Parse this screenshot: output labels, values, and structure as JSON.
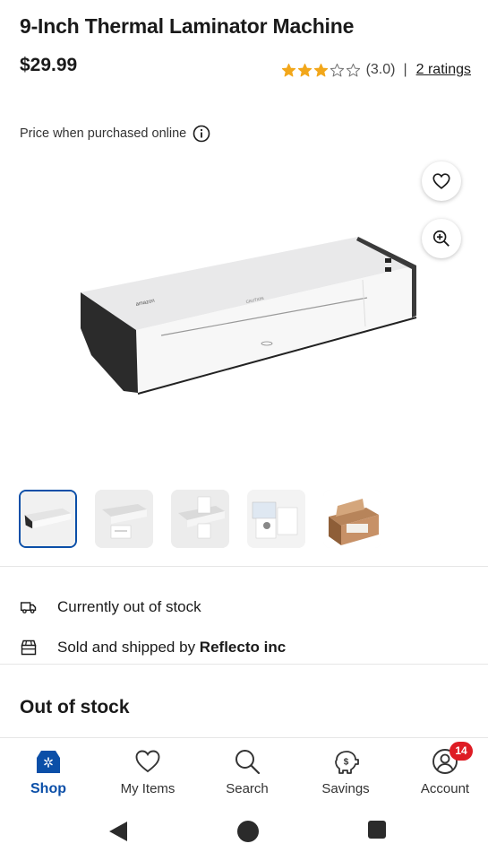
{
  "product": {
    "title": "9-Inch Thermal Laminator Machine",
    "price": "$29.99",
    "rating_value": "(3.0)",
    "rating_separator": "|",
    "ratings_link": "2 ratings",
    "stars_filled": 3,
    "stars_total": 5,
    "price_note": "Price when purchased online"
  },
  "colors": {
    "star": "#f2a71b",
    "accent": "#0b4fa8",
    "badge": "#de1c24"
  },
  "gallery": {
    "thumbnail_count": 5,
    "active_index": 0
  },
  "availability": {
    "stock_status": "Currently out of stock",
    "sold_by_prefix": "Sold and shipped by ",
    "seller": "Reflecto inc",
    "heading": "Out of stock"
  },
  "nav": {
    "items": [
      {
        "label": "Shop",
        "icon": "spark-store-icon",
        "active": true
      },
      {
        "label": "My Items",
        "icon": "heart-icon"
      },
      {
        "label": "Search",
        "icon": "search-icon"
      },
      {
        "label": "Savings",
        "icon": "piggy-bank-icon"
      },
      {
        "label": "Account",
        "icon": "account-icon",
        "badge": "14"
      }
    ]
  }
}
